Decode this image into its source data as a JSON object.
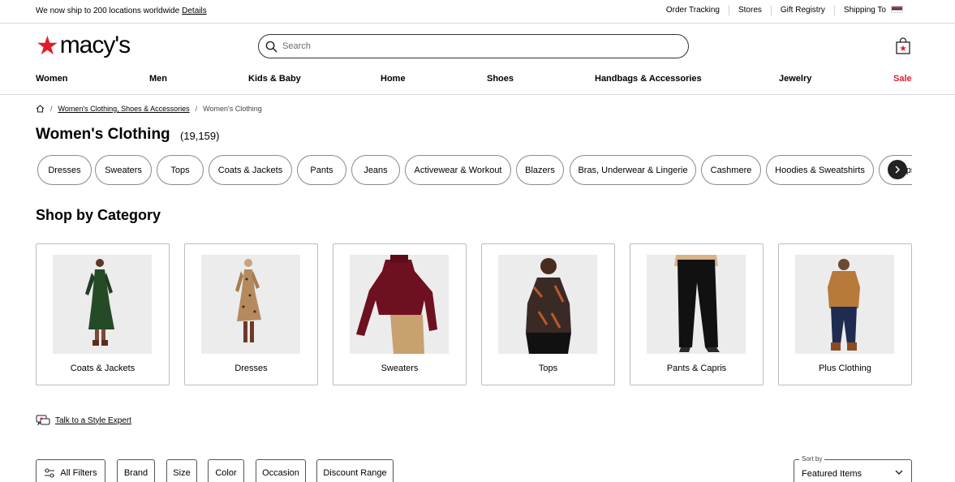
{
  "utility": {
    "ship_text": "We now ship to 200 locations worldwide",
    "ship_link": "Details",
    "links": [
      "Order Tracking",
      "Stores",
      "Gift Registry",
      "Shipping To"
    ]
  },
  "header": {
    "logo_text": "macy's",
    "search_placeholder": "Search"
  },
  "nav": {
    "items": [
      "Women",
      "Men",
      "Kids & Baby",
      "Home",
      "Shoes",
      "Handbags & Accessories",
      "Jewelry",
      "Sale"
    ]
  },
  "breadcrumb": {
    "link": "Women's Clothing, Shoes & Accessories",
    "current": "Women's Clothing"
  },
  "page": {
    "title": "Women's Clothing",
    "count": "(19,159)"
  },
  "chips": [
    "Dresses",
    "Sweaters",
    "Tops",
    "Coats & Jackets",
    "Pants",
    "Jeans",
    "Activewear & Workout",
    "Blazers",
    "Bras, Underwear & Lingerie",
    "Cashmere",
    "Hoodies & Sweatshirts",
    "Jumpsuits"
  ],
  "shop_by_category": {
    "title": "Shop by Category",
    "items": [
      "Coats & Jackets",
      "Dresses",
      "Sweaters",
      "Tops",
      "Pants & Capris",
      "Plus Clothing"
    ]
  },
  "expert": {
    "label": "Talk to a Style Expert"
  },
  "filters": {
    "buttons": [
      "All Filters",
      "Brand",
      "Size",
      "Color",
      "Occasion",
      "Discount Range"
    ],
    "sort_label": "Sort by",
    "sort_value": "Featured Items"
  },
  "colors": {
    "brand_red": "#e21a2c"
  }
}
